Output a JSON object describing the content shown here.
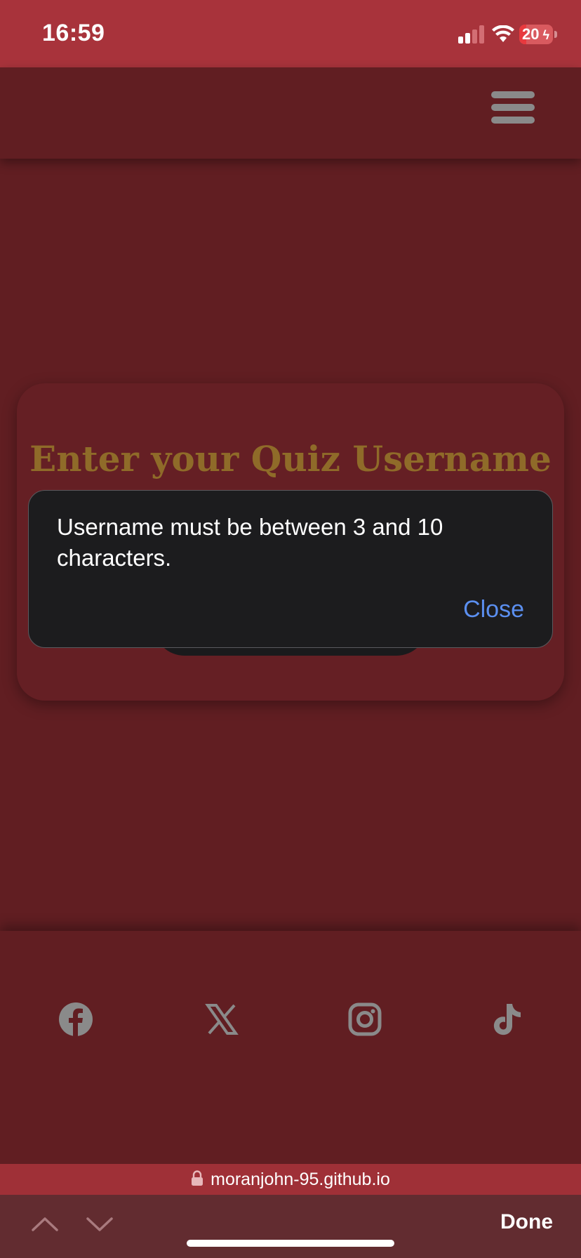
{
  "status_bar": {
    "time": "16:59",
    "battery": "20",
    "battery_level": 0.2,
    "icons": [
      "signal-icon",
      "wifi-icon",
      "battery-charging-icon"
    ]
  },
  "header": {
    "menu_icon": "hamburger-menu-icon"
  },
  "card": {
    "title": "Enter your Quiz Username"
  },
  "alert": {
    "message": "Username must be between 3 and 10 characters.",
    "close_label": "Close"
  },
  "footer": {
    "social_icons": [
      "facebook-icon",
      "x-icon",
      "instagram-icon",
      "tiktok-icon"
    ]
  },
  "browser": {
    "url": "moranjohn-95.github.io",
    "done_label": "Done"
  },
  "colors": {
    "background": "#611e22",
    "status_bar": "#a8333b",
    "title": "#8f6b29",
    "alert_bg": "#1c1c1e",
    "link": "#5b8ff0",
    "icon_gray": "#8a8a8a"
  }
}
